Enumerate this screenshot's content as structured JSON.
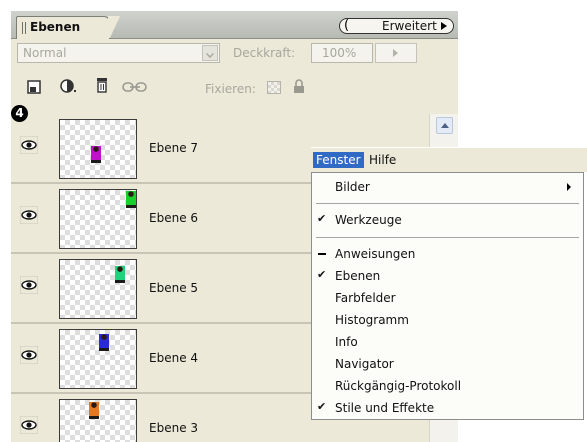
{
  "panel": {
    "tab_label": "Ebenen",
    "menu_button_label": "Erweitert",
    "blend_mode": "Normal",
    "opacity_label": "Deckkraft:",
    "opacity_value": "100%",
    "lock_label": "Fixieren:",
    "step_badge": "4"
  },
  "layers": [
    {
      "name": "Ebene 7",
      "sprite_color": "#c012c8"
    },
    {
      "name": "Ebene 6",
      "sprite_color": "#18d02c"
    },
    {
      "name": "Ebene 5",
      "sprite_color": "#1ed37c"
    },
    {
      "name": "Ebene 4",
      "sprite_color": "#2a2ad8"
    },
    {
      "name": "Ebene 3",
      "sprite_color": "#e07a26"
    }
  ],
  "menubar": {
    "active": "Fenster",
    "other": "Hilfe"
  },
  "dropdown": {
    "items": [
      {
        "label": "Bilder",
        "submenu": true
      },
      {
        "label": "Werkzeuge",
        "checked": true
      },
      {
        "label": "Anweisungen",
        "dash": true
      },
      {
        "label": "Ebenen",
        "checked": true
      },
      {
        "label": "Farbfelder"
      },
      {
        "label": "Histogramm"
      },
      {
        "label": "Info"
      },
      {
        "label": "Navigator"
      },
      {
        "label": "Rückgängig-Protokoll"
      },
      {
        "label": "Stile und Effekte",
        "checked": true
      }
    ]
  },
  "colors": {
    "panel_frame": "#3f6fb5",
    "menu_highlight": "#316ac5",
    "panel_bg": "#ece9d8"
  }
}
